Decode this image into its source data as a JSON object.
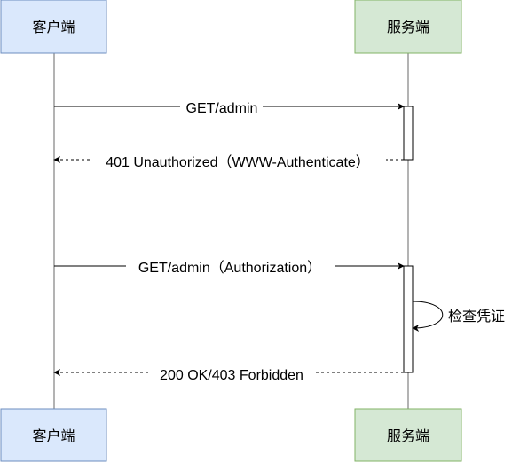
{
  "participants": {
    "client": {
      "label": "客户端",
      "fill": "#dae8fc",
      "stroke": "#6c8ebf"
    },
    "server": {
      "label": "服务端",
      "fill": "#d5e8d4",
      "stroke": "#82b366"
    }
  },
  "messages": [
    {
      "text": "GET/admin",
      "style": "solid"
    },
    {
      "text": "401 Unauthorized（WWW-Authenticate）",
      "style": "dashed"
    },
    {
      "text": "GET/admin（Authorization）",
      "style": "solid"
    },
    {
      "text": "200 OK/403 Forbidden",
      "style": "dashed"
    }
  ],
  "self_message": {
    "text": "检查凭证"
  },
  "colors": {
    "lifeline": "#b3b3b3",
    "arrow": "#000000"
  }
}
